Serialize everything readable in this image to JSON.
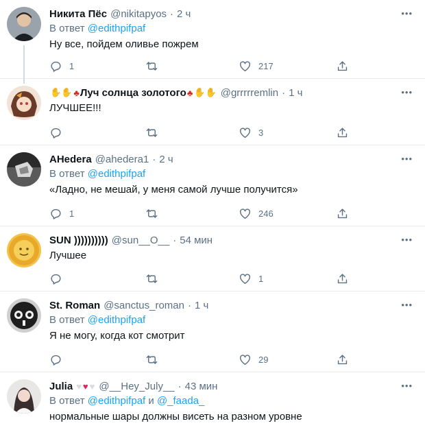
{
  "tweets": [
    {
      "name": "Никита Пёс",
      "handle": "@nikitapyos",
      "time": "2 ч",
      "reply_prefix": "В ответ",
      "reply_mentions": "@edithpifpaf",
      "text": "Ну все, пойдем оливье пожрем",
      "replies": "1",
      "retweets": "",
      "likes": "217"
    },
    {
      "name": "Луч солнца золотого",
      "handle": "@grrrrremlin",
      "time": "1 ч",
      "text": "ЛУЧШЕЕ!!!",
      "replies": "",
      "retweets": "",
      "likes": "3"
    },
    {
      "name": "AHedera",
      "handle": "@ahedera1",
      "time": "2 ч",
      "reply_prefix": "В ответ",
      "reply_mentions": "@edithpifpaf",
      "text": "«Ладно, не мешай, у меня самой лучше получится»",
      "replies": "1",
      "retweets": "",
      "likes": "246"
    },
    {
      "name": "SUN ))))))))))",
      "handle": "@sun__O__",
      "time": "54 мин",
      "text": "Лучшее",
      "replies": "",
      "retweets": "",
      "likes": "1"
    },
    {
      "name": "St. Roman",
      "handle": "@sanctus_roman",
      "time": "1 ч",
      "reply_prefix": "В ответ",
      "reply_mentions": "@edithpifpaf",
      "text": "Я не могу, когда кот смотрит",
      "replies": "",
      "retweets": "",
      "likes": "29"
    },
    {
      "name": "Julia",
      "handle": "@__Hey_July__",
      "time": "43 мин",
      "reply_prefix": "В ответ",
      "reply_mentions": "@edithpifpaf",
      "reply_and": "и",
      "reply_mentions_2": "@_faada_",
      "text": "нормальные шары должны висеть на разном уровне"
    }
  ],
  "dot": "·",
  "more_glyph": "•••",
  "colors": {
    "accent": "#1da1f2",
    "secondary_text": "#5b7083",
    "divider": "#e6ecf0",
    "thread_line": "#cfd9de"
  },
  "icons": [
    "reply-icon",
    "retweet-icon",
    "like-icon",
    "share-icon",
    "more-icon",
    "maple-leaf-icon",
    "raised-hand-icon",
    "white-heart-icon",
    "red-heart-icon"
  ]
}
